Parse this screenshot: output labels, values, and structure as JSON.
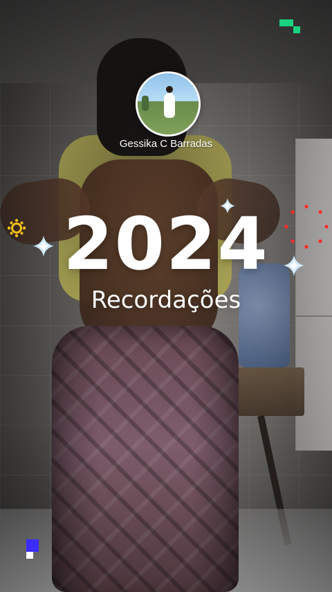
{
  "overlay": {
    "profile_name": "Gessika C Barradas",
    "title_year": "2024",
    "subtitle": "Recordações"
  },
  "icons": {
    "avatar": "profile-photo",
    "sparkles": [
      "sparkle-icon",
      "sparkle-icon",
      "sparkle-icon"
    ],
    "decor": [
      "pixel-blocks-icon",
      "sun-icon",
      "dots-burst-icon"
    ]
  },
  "colors": {
    "text": "#ffffff",
    "accent_green": "#19d27f",
    "accent_purple": "#3b2cff",
    "accent_yellow": "#f4c21a",
    "accent_red": "#ff2a2a",
    "sparkle_fill": "#cfe9ff"
  }
}
